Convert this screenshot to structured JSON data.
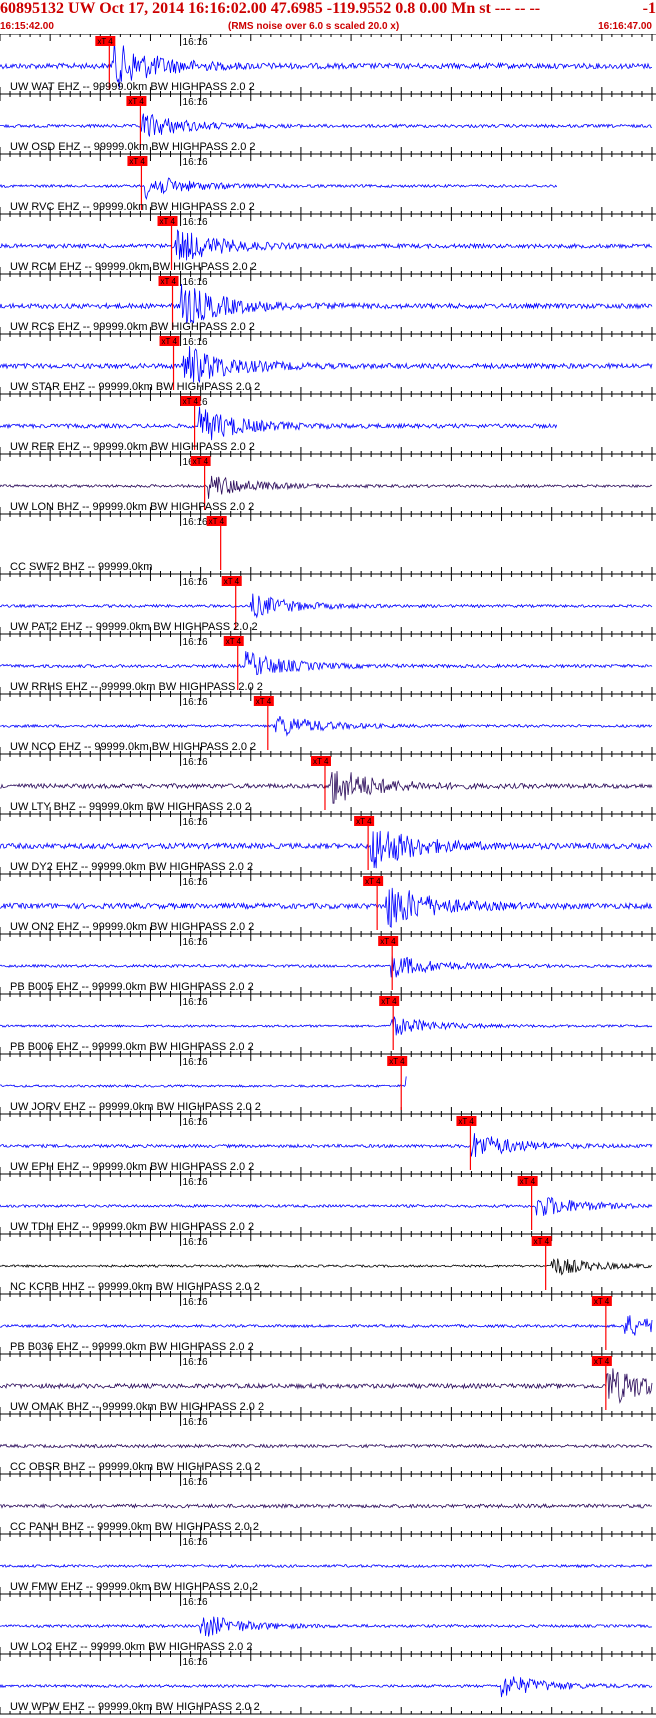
{
  "header": {
    "title": "60895132 UW Oct 17, 2014 16:16:02.00   47.6985 -119.9552  0.8 0.00 Mn st --- -- --",
    "trailing": "-1",
    "start_time": "16:15:42.00",
    "note": "(RMS noise over 6.0 s scaled 20.0 x)",
    "end_time": "16:16:47.00"
  },
  "colors": {
    "pick": "#ff0000",
    "text": "#000000",
    "blue": "#0000ff",
    "purple": "#2a0a5a",
    "black": "#000000"
  },
  "chart_data": {
    "type": "line",
    "title": "",
    "x_unit": "seconds after 16:15:42.00",
    "x_range": [
      0,
      65
    ],
    "minute_label": "16:16",
    "minute_mark_seconds": 18,
    "pick_label": "xT 4",
    "traces": [
      {
        "label": "UW WAT EHZ -- 99999.0km BW  HIGHPASS  2.0  2",
        "color": "blue",
        "pick_s": 10.5,
        "amp": 0.6,
        "burst_s": 11.2,
        "end_s": null
      },
      {
        "label": "UW OSD EHZ -- 99999.0km BW  HIGHPASS  2.0  2",
        "color": "blue",
        "pick_s": 13.6,
        "amp": 0.35,
        "burst_s": 14.0,
        "end_s": null
      },
      {
        "label": "UW RVC EHZ -- 99999.0km BW  HIGHPASS  2.0  2",
        "color": "blue",
        "pick_s": 13.7,
        "amp": 0.3,
        "burst_s": 14.5,
        "end_s": 55.5
      },
      {
        "label": "UW RCM EHZ -- 99999.0km BW  HIGHPASS  2.0  2",
        "color": "blue",
        "pick_s": 16.7,
        "amp": 0.45,
        "burst_s": 17.5,
        "end_s": null
      },
      {
        "label": "UW RCS EHZ -- 99999.0km BW  HIGHPASS  2.0  2",
        "color": "blue",
        "pick_s": 16.8,
        "amp": 0.55,
        "burst_s": 18.0,
        "end_s": null
      },
      {
        "label": "UW STAR EHZ -- 99999.0km BW  HIGHPASS  2.0  2",
        "color": "blue",
        "pick_s": 16.9,
        "amp": 0.55,
        "burst_s": 18.3,
        "end_s": null
      },
      {
        "label": "UW RER EHZ -- 99999.0km BW  HIGHPASS  2.0  2",
        "color": "blue",
        "pick_s": 19.0,
        "amp": 0.45,
        "burst_s": 19.8,
        "end_s": 55.5
      },
      {
        "label": "UW LON BHZ -- 99999.0km BW  HIGHPASS  2.0  2",
        "color": "purple",
        "pick_s": 20.0,
        "amp": 0.3,
        "burst_s": 20.8,
        "end_s": null
      },
      {
        "label": "CC SWF2 BHZ -- 99999.0km",
        "color": "none",
        "pick_s": 21.6,
        "amp": 0,
        "burst_s": 22.0,
        "end_s": null
      },
      {
        "label": "UW PAT2 EHZ -- 99999.0km BW  HIGHPASS  2.0  2",
        "color": "blue",
        "pick_s": 23.1,
        "amp": 0.3,
        "burst_s": 25.0,
        "end_s": null
      },
      {
        "label": "UW RRHS EHZ -- 99999.0km BW  HIGHPASS  2.0  2",
        "color": "blue",
        "pick_s": 23.3,
        "amp": 0.35,
        "burst_s": 24.5,
        "end_s": null
      },
      {
        "label": "UW NCO EHZ -- 99999.0km BW  HIGHPASS  2.0  2",
        "color": "blue",
        "pick_s": 26.3,
        "amp": 0.3,
        "burst_s": 27.5,
        "end_s": null
      },
      {
        "label": "UW LTY BHZ -- 99999.0km BW  HIGHPASS  2.0  2",
        "color": "purple",
        "pick_s": 32.0,
        "amp": 0.5,
        "burst_s": 33.0,
        "end_s": null
      },
      {
        "label": "UW DY2 EHZ -- 99999.0km BW  HIGHPASS  2.0  2",
        "color": "blue",
        "pick_s": 36.3,
        "amp": 0.6,
        "burst_s": 37.0,
        "end_s": null
      },
      {
        "label": "UW ON2 EHZ -- 99999.0km BW  HIGHPASS  2.0  2",
        "color": "blue",
        "pick_s": 37.2,
        "amp": 0.6,
        "burst_s": 38.5,
        "end_s": null
      },
      {
        "label": "PB B005 EHZ -- 99999.0km BW  HIGHPASS  2.0  2",
        "color": "blue",
        "pick_s": 38.7,
        "amp": 0.3,
        "burst_s": 39.0,
        "end_s": null
      },
      {
        "label": "PB B006 EHZ -- 99999.0km BW  HIGHPASS  2.0  2",
        "color": "blue",
        "pick_s": 38.8,
        "amp": 0.25,
        "burst_s": 39.0,
        "end_s": null
      },
      {
        "label": "UW JORV EHZ -- 99999.0km BW  HIGHPASS  2.0  2",
        "color": "blue",
        "pick_s": 39.6,
        "amp": 0.25,
        "burst_s": 40.5,
        "end_s": 40.5
      },
      {
        "label": "UW EPH EHZ -- 99999.0km BW  HIGHPASS  2.0  2",
        "color": "blue",
        "pick_s": 46.5,
        "amp": 0.35,
        "burst_s": 47.0,
        "end_s": null
      },
      {
        "label": "UW TDH EHZ -- 99999.0km BW  HIGHPASS  2.0  2",
        "color": "blue",
        "pick_s": 52.6,
        "amp": 0.3,
        "burst_s": 53.5,
        "end_s": null
      },
      {
        "label": "NC KCPB HHZ -- 99999.0km BW  HIGHPASS  2.0  2",
        "color": "black",
        "pick_s": 54.0,
        "amp": 0.25,
        "burst_s": 55.0,
        "end_s": null
      },
      {
        "label": "PB B036 EHZ -- 99999.0km BW  HIGHPASS  2.0  2",
        "color": "blue",
        "pick_s": 60.0,
        "amp": 0.3,
        "burst_s": 62.0,
        "end_s": null
      },
      {
        "label": "UW OMAK BHZ -- 99999.0km BW  HIGHPASS  2.0  2",
        "color": "purple",
        "pick_s": 60.0,
        "amp": 0.5,
        "burst_s": 60.5,
        "end_s": null
      },
      {
        "label": "CC OBSR BHZ -- 99999.0km BW  HIGHPASS  2.0  2",
        "color": "purple",
        "pick_s": null,
        "amp": 0.35,
        "burst_s": null,
        "end_s": null
      },
      {
        "label": "CC PANH BHZ -- 99999.0km BW  HIGHPASS  2.0  2",
        "color": "purple",
        "pick_s": null,
        "amp": 0.4,
        "burst_s": null,
        "end_s": null
      },
      {
        "label": "UW FMW EHZ -- 99999.0km BW  HIGHPASS  2.0  2",
        "color": "blue",
        "pick_s": null,
        "amp": 0.3,
        "burst_s": null,
        "end_s": null
      },
      {
        "label": "UW LO2 EHZ -- 99999.0km BW  HIGHPASS  2.0  2",
        "color": "blue",
        "pick_s": null,
        "amp": 0.3,
        "burst_s": 20.0,
        "end_s": null
      },
      {
        "label": "UW WPW EHZ -- 99999.0km BW  HIGHPASS  2.0  2",
        "color": "blue",
        "pick_s": null,
        "amp": 0.3,
        "burst_s": 50.0,
        "end_s": null
      }
    ]
  }
}
